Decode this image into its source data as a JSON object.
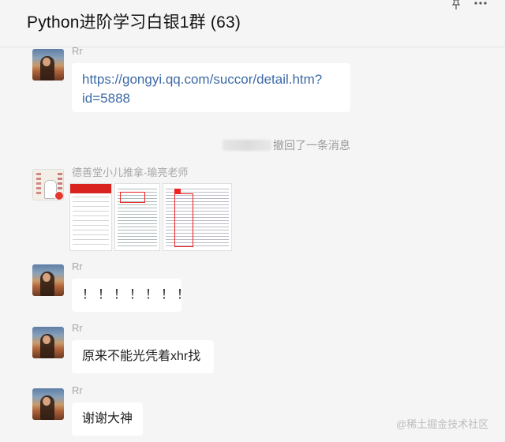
{
  "window": {
    "title": "Python进阶学习白银1群 (63)"
  },
  "messages": [
    {
      "sender": "Rr",
      "text": "https://gongyi.qq.com/succor/detail.htm?id=5888",
      "line1": "https://gongyi.qq.com/succor/detail.htm?",
      "line2": "id=5888",
      "type": "link"
    },
    {
      "type": "recall",
      "text": "撤回了一条消息"
    },
    {
      "sender": "德善堂小儿推拿-瑜亮老师",
      "type": "images",
      "image_count": 3
    },
    {
      "sender": "Rr",
      "text": "！！！！！！！",
      "type": "text"
    },
    {
      "sender": "Rr",
      "text": "原来不能光凭着xhr找",
      "type": "text"
    },
    {
      "sender": "Rr",
      "text": "谢谢大神",
      "type": "text"
    }
  ],
  "watermark": "@稀土掘金技术社区",
  "icons": [
    "pin-icon",
    "more-icon"
  ]
}
